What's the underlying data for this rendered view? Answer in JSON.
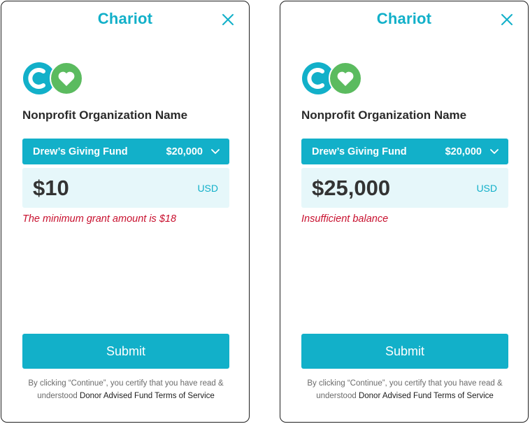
{
  "colors": {
    "brand": "#12b0c9",
    "heart_green": "#5bbb5f",
    "error": "#c8102e",
    "input_bg": "#e6f7fa"
  },
  "panels": [
    {
      "brand": "Chariot",
      "org_name": "Nonprofit Organization Name",
      "fund_name": "Drew’s Giving Fund",
      "fund_balance": "$20,000",
      "amount": "$10",
      "currency": "USD",
      "error": "The minimum grant amount is $18",
      "submit_label": "Submit",
      "legal_text": "By clicking “Continue”, you certify that you have read & understood",
      "legal_link": "Donor Advised Fund Terms of Service"
    },
    {
      "brand": "Chariot",
      "org_name": "Nonprofit Organization Name",
      "fund_name": "Drew’s Giving Fund",
      "fund_balance": "$20,000",
      "amount": "$25,000",
      "currency": "USD",
      "error": "Insufficient balance",
      "submit_label": "Submit",
      "legal_text": "By clicking “Continue”, you certify that you have read & understood",
      "legal_link": "Donor Advised Fund Terms of Service"
    }
  ]
}
